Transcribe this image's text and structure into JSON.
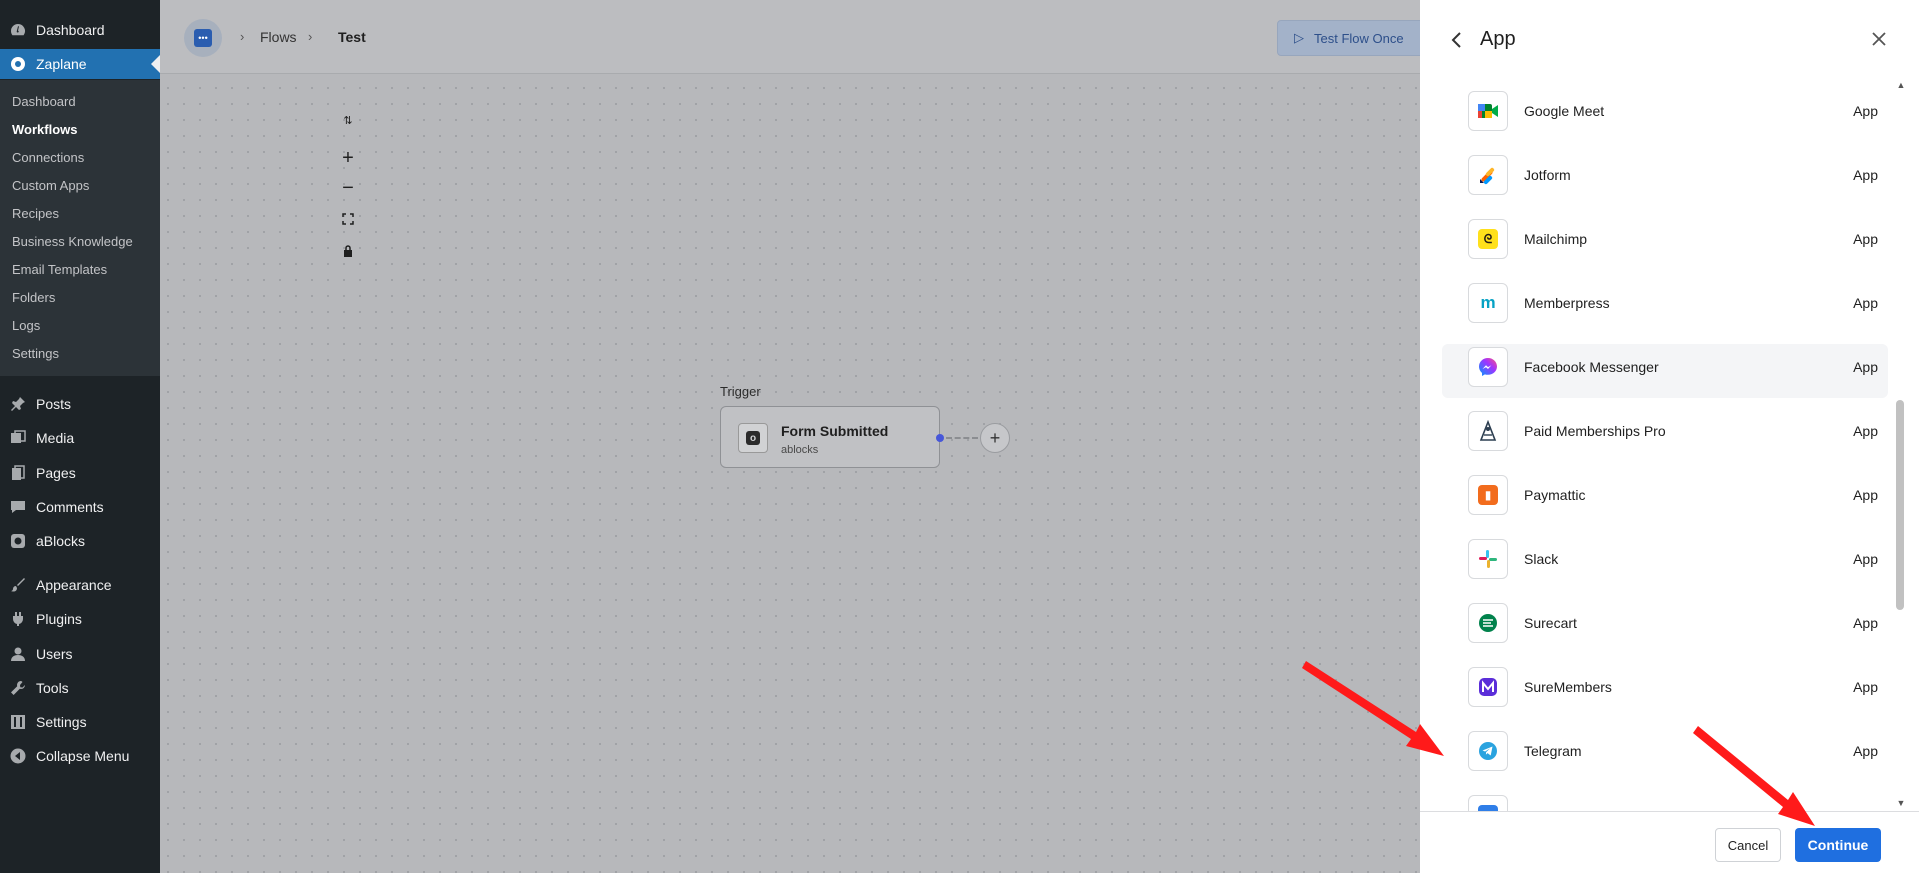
{
  "wp_sidebar": {
    "dashboard": "Dashboard",
    "zaplane": "Zaplane",
    "submenu": [
      "Dashboard",
      "Workflows",
      "Connections",
      "Custom Apps",
      "Recipes",
      "Business Knowledge",
      "Email Templates",
      "Folders",
      "Logs",
      "Settings"
    ],
    "current_submenu": "Workflows",
    "posts": "Posts",
    "media": "Media",
    "pages": "Pages",
    "comments": "Comments",
    "ablocks": "aBlocks",
    "appearance": "Appearance",
    "plugins": "Plugins",
    "users": "Users",
    "tools": "Tools",
    "settings": "Settings",
    "collapse": "Collapse Menu"
  },
  "header": {
    "crumb_flows": "Flows",
    "crumb_test": "Test",
    "test_flow_label": "Test Flow Once"
  },
  "canvas": {
    "trigger_label": "Trigger",
    "trigger_title": "Form Submitted",
    "trigger_subtitle": "ablocks"
  },
  "drawer": {
    "title": "App",
    "apps": [
      {
        "name": "Google Meet",
        "type": "App",
        "icon": "google-meet-icon",
        "color": "#00832d"
      },
      {
        "name": "Jotform",
        "type": "App",
        "icon": "jotform-icon",
        "color": "#ff6100"
      },
      {
        "name": "Mailchimp",
        "type": "App",
        "icon": "mailchimp-icon",
        "color": "#ffe01b"
      },
      {
        "name": "Memberpress",
        "type": "App",
        "icon": "memberpress-icon",
        "color": "#06a2c4"
      },
      {
        "name": "Facebook Messenger",
        "type": "App",
        "icon": "messenger-icon",
        "color": "#a334fa"
      },
      {
        "name": "Paid Memberships Pro",
        "type": "App",
        "icon": "paid-memberships-pro-icon",
        "color": "#2c3e50"
      },
      {
        "name": "Paymattic",
        "type": "App",
        "icon": "paymattic-icon",
        "color": "#f26c1d"
      },
      {
        "name": "Slack",
        "type": "App",
        "icon": "slack-icon",
        "color": "#e01e5a"
      },
      {
        "name": "Surecart",
        "type": "App",
        "icon": "surecart-icon",
        "color": "#01824c"
      },
      {
        "name": "SureMembers",
        "type": "App",
        "icon": "suremembers-icon",
        "color": "#5b2ed9"
      },
      {
        "name": "Telegram",
        "type": "App",
        "icon": "telegram-icon",
        "color": "#2aa3df"
      }
    ],
    "hovered_app": "Facebook Messenger",
    "cancel_label": "Cancel",
    "continue_label": "Continue"
  },
  "colors": {
    "wp_sidebar_bg": "#1d2327",
    "wp_active": "#2271b1",
    "primary_button": "#1f6fe0",
    "annotation_arrow": "#ff1a1a"
  }
}
